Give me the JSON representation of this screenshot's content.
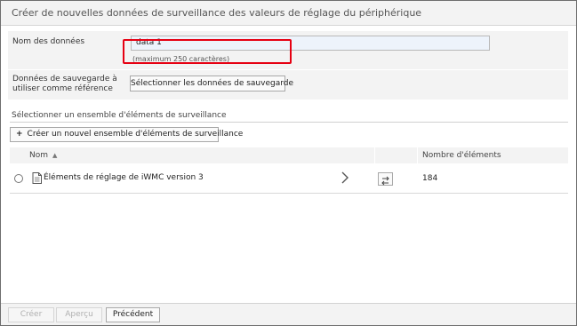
{
  "dialog": {
    "title": "Créer de nouvelles données de surveillance des valeurs de réglage du périphérique"
  },
  "form": {
    "data_name_label": "Nom des données",
    "data_name_value": "data 1",
    "data_name_hint": "(maximum 250 caractères)",
    "backup_label_line1": "Données de sauvegarde à",
    "backup_label_line2": "utiliser comme référence",
    "select_backup_button": "Sélectionner les données de sauvegarde"
  },
  "monitoring_set": {
    "section_title": "Sélectionner un ensemble d'éléments de surveillance",
    "new_button_plus": "+",
    "new_button": "Créer un nouvel ensemble d'éléments de surveillance",
    "columns": {
      "name": "Nom",
      "sort_indicator": "▲",
      "count": "Nombre d'éléments"
    },
    "rows": [
      {
        "name": "Éléments de réglage de iWMC version 3",
        "count": "184"
      }
    ]
  },
  "footer": {
    "create": "Créer",
    "preview": "Aperçu",
    "previous": "Précédent"
  },
  "icons": [
    "document-icon",
    "chevron-right-icon",
    "swap-icon",
    "radio-button"
  ],
  "colors": {
    "highlight": "#e60012",
    "header_bg": "#f3f3f3",
    "input_bg": "#edf3fb"
  }
}
